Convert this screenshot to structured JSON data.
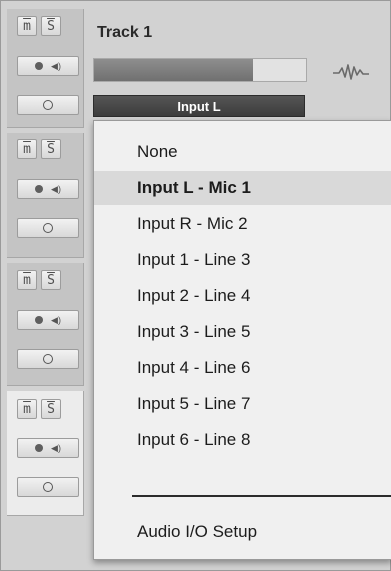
{
  "track": {
    "title": "Track 1",
    "meter_level": 0.75,
    "input_label": "Input L"
  },
  "strip_buttons": {
    "mute": "m",
    "solo": "S",
    "speaker": "◀)"
  },
  "menu": {
    "items": [
      {
        "label": "None",
        "selected": false
      },
      {
        "label": "Input L - Mic 1",
        "selected": true
      },
      {
        "label": "Input R - Mic 2",
        "selected": false
      },
      {
        "label": "Input 1 - Line 3",
        "selected": false
      },
      {
        "label": "Input 2 - Line 4",
        "selected": false
      },
      {
        "label": "Input 3 - Line 5",
        "selected": false
      },
      {
        "label": "Input 4 - Line 6",
        "selected": false
      },
      {
        "label": "Input 5 - Line 7",
        "selected": false
      },
      {
        "label": "Input 6 - Line 8",
        "selected": false
      }
    ],
    "footer_item": "Audio I/O Setup"
  }
}
